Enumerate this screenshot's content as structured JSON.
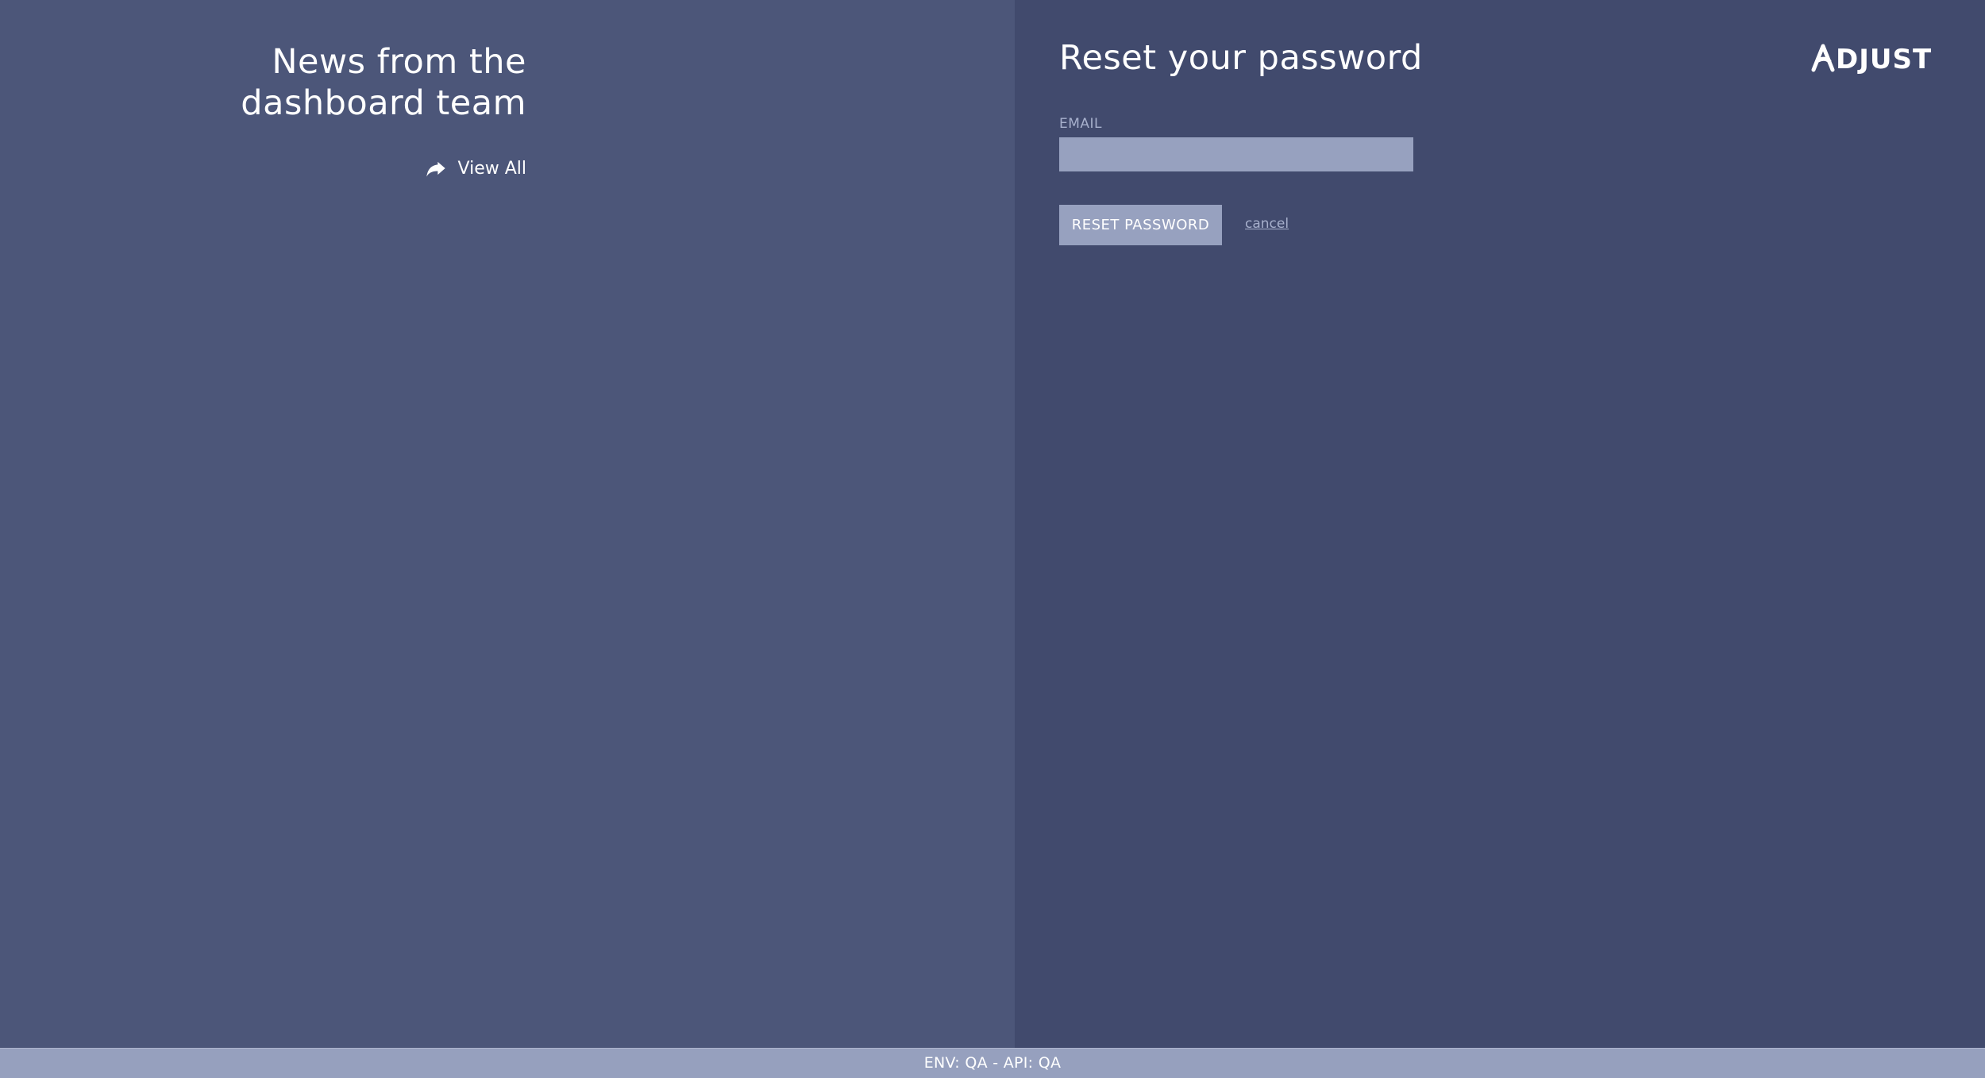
{
  "news": {
    "title": "News from the dashboard team",
    "view_all_label": "View All",
    "view_all_icon": "share-arrow-icon"
  },
  "reset": {
    "title": "Reset your password",
    "email_label": "EMAIL",
    "email_value": "",
    "button_label": "RESET PASSWORD",
    "cancel_label": "cancel"
  },
  "brand": {
    "logo_text": "ADJUST"
  },
  "footer": {
    "env_text": "ENV: QA - API: QA"
  },
  "colors": {
    "left_panel": "#4c5679",
    "right_panel": "#414a6d",
    "input_bg": "#97a1bf",
    "button_bg": "#97a1bf",
    "footer_bg": "#96a0be",
    "muted_text": "#a7b0cc"
  }
}
